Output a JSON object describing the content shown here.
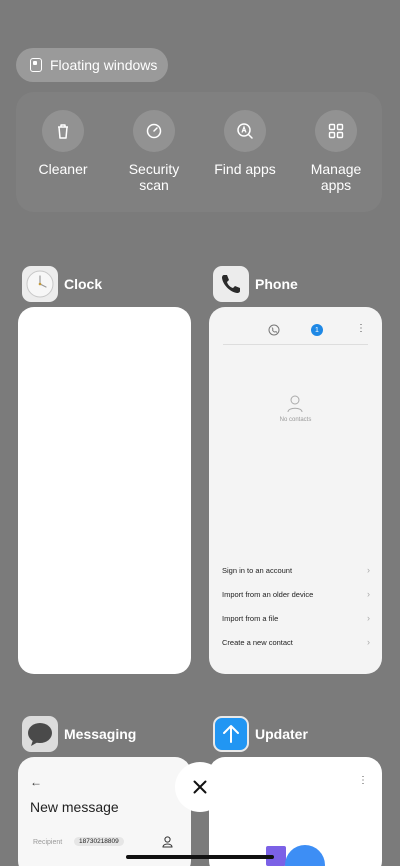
{
  "floating_windows": {
    "label": "Floating windows",
    "icon": "floating-window-icon"
  },
  "tools": [
    {
      "label": "Cleaner",
      "icon": "trash-icon"
    },
    {
      "label": "Security scan",
      "icon": "gauge-icon"
    },
    {
      "label": "Find apps",
      "icon": "search-apps-icon"
    },
    {
      "label": "Manage apps",
      "icon": "grid-icon"
    }
  ],
  "apps": {
    "clock": {
      "name": "Clock"
    },
    "phone": {
      "name": "Phone",
      "empty_text": "No contacts",
      "badge": "1",
      "options": [
        "Sign in to an account",
        "Import from an older device",
        "Import from a file",
        "Create a new contact"
      ]
    },
    "messaging": {
      "name": "Messaging",
      "back": "←",
      "title": "New message",
      "recipient_label": "Recipient",
      "recipient_value": "18730218809"
    },
    "updater": {
      "name": "Updater"
    }
  },
  "colors": {
    "background": "#7b7b7b",
    "panel": "#808080",
    "phone_accent": "#1e88e5",
    "updater_icon": "#2196f3"
  }
}
